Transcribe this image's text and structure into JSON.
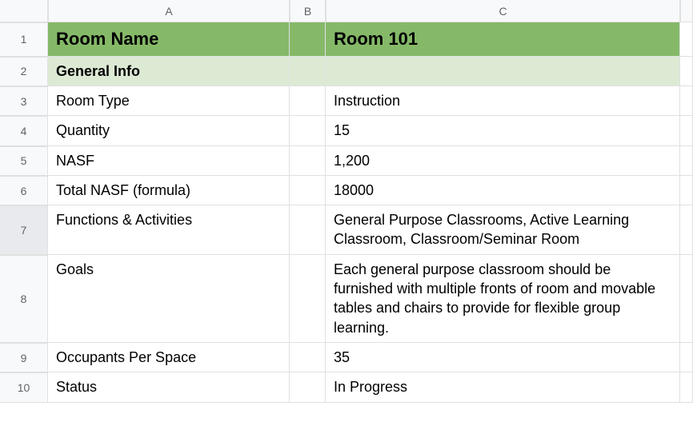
{
  "columns": {
    "a": "A",
    "b": "B",
    "c": "C"
  },
  "rows": {
    "r1": "1",
    "r2": "2",
    "r3": "3",
    "r4": "4",
    "r5": "5",
    "r6": "6",
    "r7": "7",
    "r8": "8",
    "r9": "9",
    "r10": "10"
  },
  "cells": {
    "a1": "Room Name",
    "c1": "Room 101",
    "a2": "General Info",
    "c2": "",
    "a3": "Room Type",
    "c3": "Instruction",
    "a4": "Quantity",
    "c4": "15",
    "a5": "NASF",
    "c5": "1,200",
    "a6": "Total NASF (formula)",
    "c6": "18000",
    "a7": "Functions & Activities",
    "c7": "General Purpose Classrooms, Active Learning Classroom, Classroom/Seminar Room",
    "a8": "Goals",
    "c8": "Each general purpose classroom should be furnished with multiple fronts of room and movable tables and chairs to provide for flexible group learning.",
    "a9": "Occupants Per Space",
    "c9": "35",
    "a10": "Status",
    "c10": "In Progress"
  }
}
